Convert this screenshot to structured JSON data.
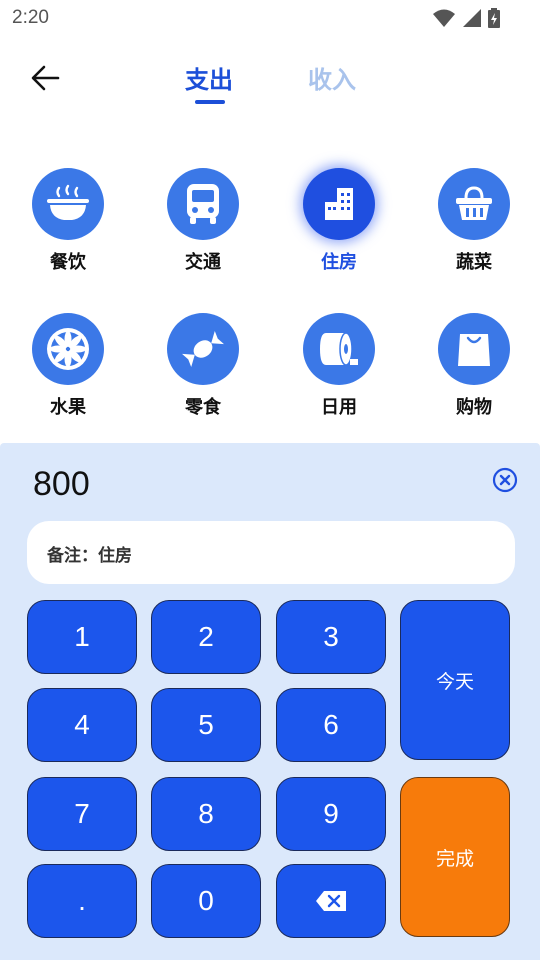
{
  "status": {
    "time": "2:20"
  },
  "header": {
    "tabs": [
      "支出",
      "收入"
    ]
  },
  "categories": [
    {
      "label": "餐饮",
      "icon": "bowl-icon"
    },
    {
      "label": "交通",
      "icon": "bus-icon"
    },
    {
      "label": "住房",
      "icon": "building-icon",
      "selected": true
    },
    {
      "label": "蔬菜",
      "icon": "basket-icon"
    },
    {
      "label": "水果",
      "icon": "citrus-icon"
    },
    {
      "label": "零食",
      "icon": "candy-icon"
    },
    {
      "label": "日用",
      "icon": "tissue-roll-icon"
    },
    {
      "label": "购物",
      "icon": "shopping-bag-icon"
    }
  ],
  "panel": {
    "amount": "800",
    "note": "备注：住房"
  },
  "keypad": {
    "k1": "1",
    "k2": "2",
    "k3": "3",
    "k4": "4",
    "k5": "5",
    "k6": "6",
    "k7": "7",
    "k8": "8",
    "k9": "9",
    "dot": ".",
    "k0": "0",
    "today": "今天",
    "done": "完成"
  },
  "colors": {
    "accent": "#1c56ec",
    "done": "#f77b0b",
    "panel_bg": "#dbe8fb"
  }
}
